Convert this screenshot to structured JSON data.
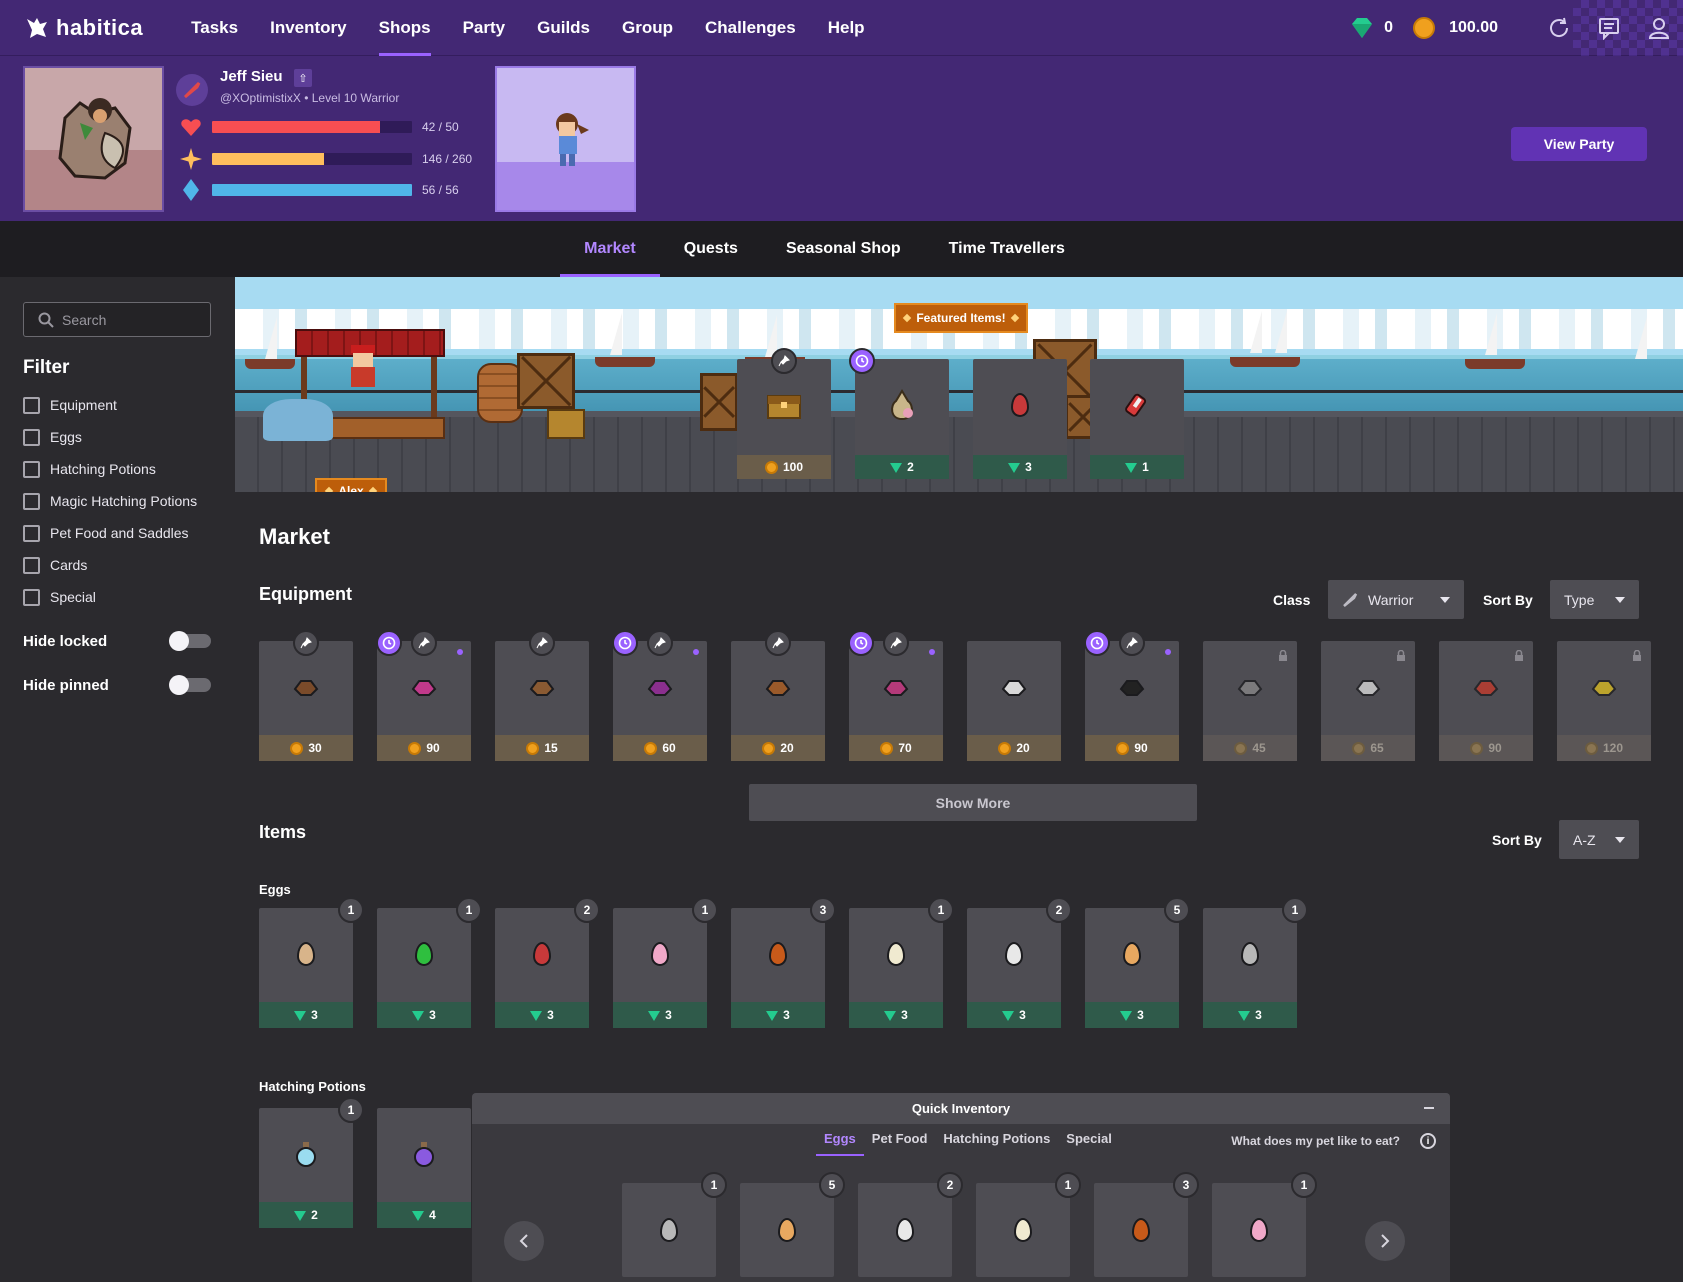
{
  "topbar": {
    "brand": "habitica",
    "nav": [
      "Tasks",
      "Inventory",
      "Shops",
      "Party",
      "Guilds",
      "Group",
      "Challenges",
      "Help"
    ],
    "active_nav": "Shops",
    "gems": "0",
    "gold": "100.00"
  },
  "header": {
    "name": "Jeff Sieu",
    "handle": "@XOptimistixX • Level 10 Warrior",
    "stats": [
      {
        "name": "health",
        "text": "42 / 50",
        "fraction": 0.84,
        "color": "#f74e52"
      },
      {
        "name": "experience",
        "text": "146 / 260",
        "fraction": 0.5615,
        "color": "#ffbe5d"
      },
      {
        "name": "mana",
        "text": "56 / 56",
        "fraction": 1.0,
        "color": "#50b5e9"
      }
    ],
    "view_party": "View Party"
  },
  "subnav": {
    "tabs": [
      "Market",
      "Quests",
      "Seasonal Shop",
      "Time Travellers"
    ],
    "active": "Market"
  },
  "sidebar": {
    "search_placeholder": "Search",
    "filter_title": "Filter",
    "filters": [
      "Equipment",
      "Eggs",
      "Hatching Potions",
      "Magic Hatching Potions",
      "Pet Food and Saddles",
      "Cards",
      "Special"
    ],
    "hide_locked": "Hide locked",
    "hide_pinned": "Hide pinned"
  },
  "banner": {
    "featured_label": "Featured Items!",
    "npc_name": "Alex",
    "featured": [
      {
        "price": "100",
        "currency": "gold",
        "icon": "chest-icon"
      },
      {
        "price": "2",
        "currency": "gem",
        "icon": "saddle-bag-icon"
      },
      {
        "price": "3",
        "currency": "gem",
        "icon": "red-egg-icon"
      },
      {
        "price": "1",
        "currency": "gem",
        "icon": "meat-icon"
      }
    ]
  },
  "market": {
    "title": "Market",
    "equipment_title": "Equipment",
    "class_label": "Class",
    "class_value": "Warrior",
    "sort_label": "Sort By",
    "sort_value": "Type",
    "equipment": [
      {
        "price": "30",
        "pin": true,
        "clock": false,
        "dot": false,
        "locked": false,
        "color": "#7a4b2a"
      },
      {
        "price": "90",
        "pin": true,
        "clock": true,
        "dot": true,
        "locked": false,
        "color": "#c0398a"
      },
      {
        "price": "15",
        "pin": true,
        "clock": false,
        "dot": false,
        "locked": false,
        "color": "#8a5a32"
      },
      {
        "price": "60",
        "pin": true,
        "clock": true,
        "dot": true,
        "locked": false,
        "color": "#8b2f8e"
      },
      {
        "price": "20",
        "pin": true,
        "clock": false,
        "dot": false,
        "locked": false,
        "color": "#9a5a2a"
      },
      {
        "price": "70",
        "pin": true,
        "clock": true,
        "dot": true,
        "locked": false,
        "color": "#b43a7a"
      },
      {
        "price": "20",
        "pin": false,
        "clock": false,
        "dot": false,
        "locked": false,
        "color": "#d8d8d8"
      },
      {
        "price": "90",
        "pin": true,
        "clock": true,
        "dot": true,
        "locked": false,
        "color": "#222222"
      },
      {
        "price": "45",
        "pin": false,
        "clock": false,
        "dot": false,
        "locked": true,
        "color": "#8a8a8a"
      },
      {
        "price": "65",
        "pin": false,
        "clock": false,
        "dot": false,
        "locked": true,
        "color": "#e0e0e0"
      },
      {
        "price": "90",
        "pin": false,
        "clock": false,
        "dot": false,
        "locked": true,
        "color": "#c93a2a"
      },
      {
        "price": "120",
        "pin": false,
        "clock": false,
        "dot": false,
        "locked": true,
        "color": "#e0c020"
      }
    ],
    "show_more": "Show More",
    "items_title": "Items",
    "items_sort_label": "Sort By",
    "items_sort_value": "A-Z",
    "eggs_title": "Eggs",
    "eggs": [
      {
        "qty": "1",
        "price": "3",
        "color": "#d8b48a"
      },
      {
        "qty": "1",
        "price": "3",
        "color": "#2fbf3f"
      },
      {
        "qty": "2",
        "price": "3",
        "color": "#c8393a"
      },
      {
        "qty": "1",
        "price": "3",
        "color": "#f0a8c8"
      },
      {
        "qty": "3",
        "price": "3",
        "color": "#c85a1a"
      },
      {
        "qty": "1",
        "price": "3",
        "color": "#f0ead0"
      },
      {
        "qty": "2",
        "price": "3",
        "color": "#e8e8e8"
      },
      {
        "qty": "5",
        "price": "3",
        "color": "#e8a860"
      },
      {
        "qty": "1",
        "price": "3",
        "color": "#b8b8b8"
      }
    ],
    "potions_title": "Hatching Potions",
    "potions": [
      {
        "qty": "1",
        "price": "2",
        "color": "#9adcf0"
      },
      {
        "qty": "",
        "price": "4",
        "color": "#8a5ae0"
      }
    ]
  },
  "quick_inventory": {
    "title": "Quick Inventory",
    "tabs": [
      "Eggs",
      "Pet Food",
      "Hatching Potions",
      "Special"
    ],
    "active_tab": "Eggs",
    "help": "What does my pet like to eat?",
    "items": [
      {
        "qty": "1",
        "color": "#b8b8b8"
      },
      {
        "qty": "5",
        "color": "#e8a860"
      },
      {
        "qty": "2",
        "color": "#e8e8e8"
      },
      {
        "qty": "1",
        "color": "#f0ead0"
      },
      {
        "qty": "3",
        "color": "#c85a1a"
      },
      {
        "qty": "1",
        "color": "#f0a8c8"
      }
    ]
  }
}
